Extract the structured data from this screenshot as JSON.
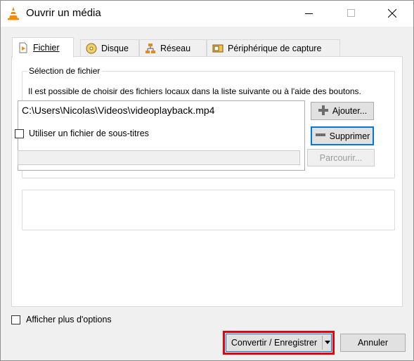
{
  "window": {
    "title": "Ouvrir un média",
    "controls": {
      "minimize": "minimize-icon",
      "maximize": "maximize-icon",
      "close": "close-icon"
    }
  },
  "tabs": [
    {
      "label": "Fichier",
      "icon": "file-icon",
      "active": true
    },
    {
      "label": "Disque",
      "icon": "disc-icon",
      "active": false
    },
    {
      "label": "Réseau",
      "icon": "network-icon",
      "active": false
    },
    {
      "label": "Périphérique de capture",
      "icon": "capture-device-icon",
      "active": false
    }
  ],
  "file_selection": {
    "group_label": "Sélection de fichier",
    "description": "Il est possible de choisir des fichiers locaux dans la liste suivante ou à l'aide des boutons.",
    "files": [
      "C:\\Users\\Nicolas\\Videos\\videoplayback.mp4"
    ],
    "add_button": "Ajouter...",
    "remove_button": "Supprimer"
  },
  "subtitles": {
    "checkbox_label": "Utiliser un fichier de sous-titres",
    "checked": false,
    "path_value": "",
    "browse_button": "Parcourir..."
  },
  "footer": {
    "more_options_label": "Afficher plus d'options",
    "more_options_checked": false,
    "convert_button": "Convertir / Enregistrer",
    "cancel_button": "Annuler"
  },
  "colors": {
    "highlight_outline": "#e8000d",
    "focus_border": "#0078d7",
    "vlc_orange": "#f28c00"
  }
}
